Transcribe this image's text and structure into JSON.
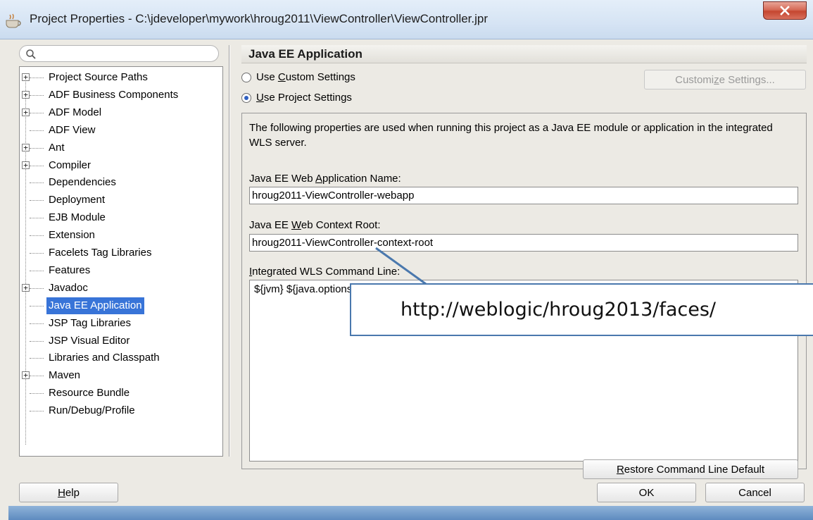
{
  "window": {
    "title": "Project Properties - C:\\jdeveloper\\mywork\\hroug2011\\ViewController\\ViewController.jpr",
    "close_label": "x"
  },
  "navigator": {
    "search_placeholder": "",
    "items": [
      {
        "label": "Project Source Paths",
        "expandable": true
      },
      {
        "label": "ADF Business Components",
        "expandable": true
      },
      {
        "label": "ADF Model",
        "expandable": true
      },
      {
        "label": "ADF View",
        "expandable": false
      },
      {
        "label": "Ant",
        "expandable": true
      },
      {
        "label": "Compiler",
        "expandable": true
      },
      {
        "label": "Dependencies",
        "expandable": false
      },
      {
        "label": "Deployment",
        "expandable": false
      },
      {
        "label": "EJB Module",
        "expandable": false
      },
      {
        "label": "Extension",
        "expandable": false
      },
      {
        "label": "Facelets Tag Libraries",
        "expandable": false
      },
      {
        "label": "Features",
        "expandable": false
      },
      {
        "label": "Javadoc",
        "expandable": true
      },
      {
        "label": "Java EE Application",
        "expandable": false,
        "selected": true
      },
      {
        "label": "JSP Tag Libraries",
        "expandable": false
      },
      {
        "label": "JSP Visual Editor",
        "expandable": false
      },
      {
        "label": "Libraries and Classpath",
        "expandable": false
      },
      {
        "label": "Maven",
        "expandable": true
      },
      {
        "label": "Resource Bundle",
        "expandable": false
      },
      {
        "label": "Run/Debug/Profile",
        "expandable": false
      }
    ]
  },
  "panel": {
    "title": "Java EE Application",
    "radio_custom": {
      "pre": "Use ",
      "mnemonic": "C",
      "post": "ustom Settings",
      "checked": false
    },
    "radio_project": {
      "pre": "",
      "mnemonic": "U",
      "post": "se Project Settings",
      "checked": true
    },
    "customize_button": {
      "pre": "Customi",
      "mnemonic": "z",
      "post": "e Settings..."
    },
    "description": "The following properties are used when running this project as a Java EE module or application in the integrated WLS server.",
    "app_name_label": {
      "pre": "Java EE Web ",
      "mnemonic": "A",
      "post": "pplication Name:"
    },
    "app_name_value": "hroug2011-ViewController-webapp",
    "context_root_label": {
      "pre": "Java EE ",
      "mnemonic": "W",
      "post": "eb Context Root:"
    },
    "context_root_value": "hroug2011-ViewController-context-root",
    "cmdline_label": {
      "pre": "",
      "mnemonic": "I",
      "post": "ntegrated WLS Command Line:"
    },
    "cmdline_value": "${jvm} ${java.options}",
    "restore_button": {
      "pre": "",
      "mnemonic": "R",
      "post": "estore Command Line Default"
    }
  },
  "callout": {
    "text": "http://weblogic/hroug2013/faces/"
  },
  "footer": {
    "help_button": {
      "pre": "",
      "mnemonic": "H",
      "post": "elp"
    },
    "ok_button": "OK",
    "cancel_button": "Cancel"
  },
  "colors": {
    "selection": "#3874d8",
    "callout_border": "#4a78ad",
    "close_button": "#c54630"
  }
}
